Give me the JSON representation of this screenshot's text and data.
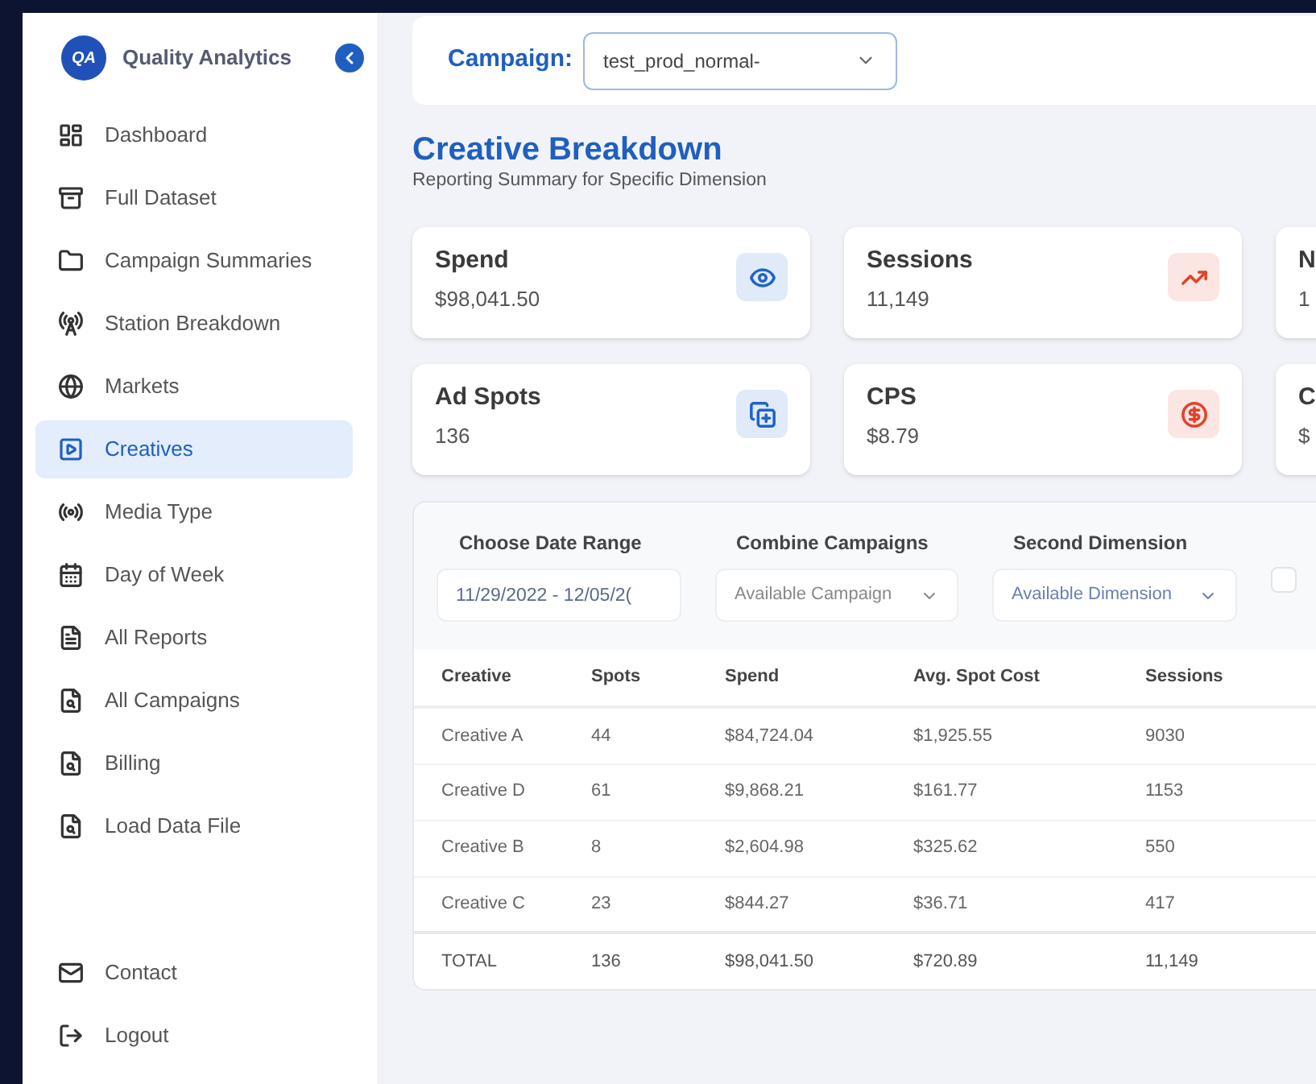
{
  "brand": {
    "logo": "QA",
    "name": "Quality Analytics"
  },
  "sidebar": {
    "items": [
      {
        "label": "Dashboard",
        "selected": false
      },
      {
        "label": "Full Dataset",
        "selected": false
      },
      {
        "label": "Campaign Summaries",
        "selected": false
      },
      {
        "label": "Station Breakdown",
        "selected": false
      },
      {
        "label": "Markets",
        "selected": false
      },
      {
        "label": "Creatives",
        "selected": true
      },
      {
        "label": "Media Type",
        "selected": false
      },
      {
        "label": "Day of Week",
        "selected": false
      },
      {
        "label": "All Reports",
        "selected": false
      },
      {
        "label": "All Campaigns",
        "selected": false
      },
      {
        "label": "Billing",
        "selected": false
      },
      {
        "label": "Load Data File",
        "selected": false
      }
    ],
    "footer_items": [
      {
        "label": "Contact"
      },
      {
        "label": "Logout"
      }
    ]
  },
  "campaign": {
    "label": "Campaign:",
    "value": "test_prod_normal-"
  },
  "page": {
    "title": "Creative Breakdown",
    "subtitle": "Reporting Summary for Specific Dimension"
  },
  "stats": [
    {
      "label": "Spend",
      "value": "$98,041.50",
      "color": "#1f64c8"
    },
    {
      "label": "Sessions",
      "value": "11,149",
      "color": "#e2432a"
    },
    {
      "label": "N",
      "value": "1"
    },
    {
      "label": "Ad Spots",
      "value": "136",
      "color": "#1f64c8"
    },
    {
      "label": "CPS",
      "value": "$8.79",
      "color": "#e2432a"
    },
    {
      "label": "C",
      "value": "$"
    }
  ],
  "filters": {
    "date_range": {
      "label": "Choose Date Range",
      "value": "11/29/2022 - 12/05/2("
    },
    "combine": {
      "label": "Combine Campaigns",
      "placeholder": "Available Campaign"
    },
    "dimension": {
      "label": "Second Dimension",
      "placeholder": "Available Dimension"
    },
    "checkbox": {
      "checked": false
    }
  },
  "table": {
    "columns": [
      "Creative",
      "Spots",
      "Spend",
      "Avg. Spot Cost",
      "Sessions"
    ],
    "rows": [
      [
        "Creative A",
        "44",
        "$84,724.04",
        "$1,925.55",
        "9030"
      ],
      [
        "Creative D",
        "61",
        "$9,868.21",
        "$161.77",
        "1153"
      ],
      [
        "Creative B",
        "8",
        "$2,604.98",
        "$325.62",
        "550"
      ],
      [
        "Creative C",
        "23",
        "$844.27",
        "$36.71",
        "417"
      ]
    ],
    "total": [
      "TOTAL",
      "136",
      "$98,041.50",
      "$720.89",
      "11,149"
    ]
  }
}
